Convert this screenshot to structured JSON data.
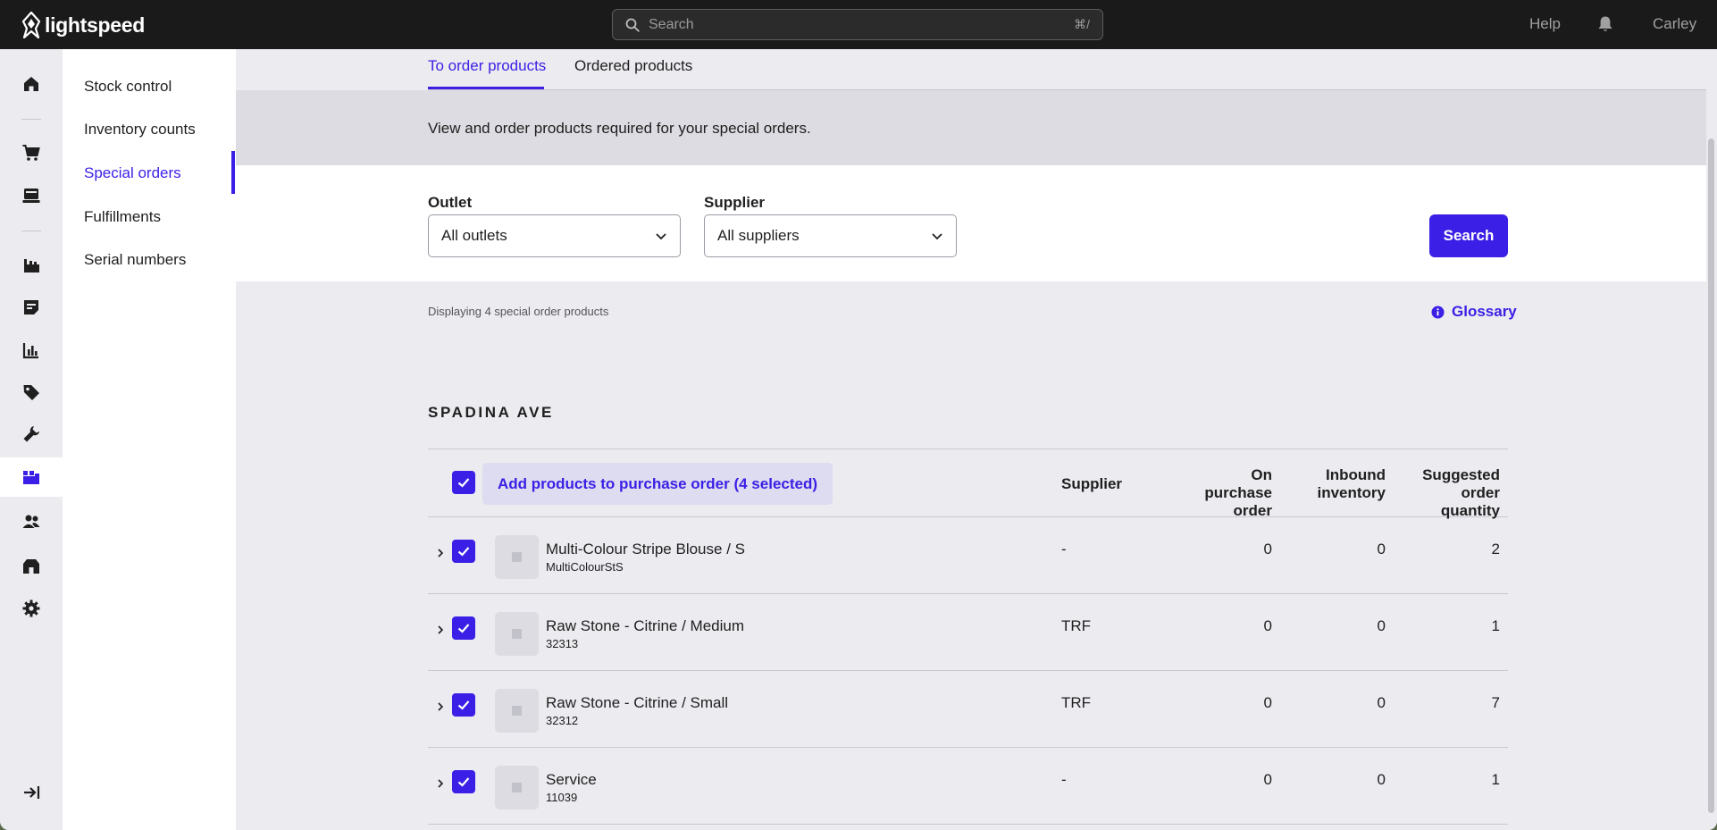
{
  "app": {
    "logo_text": "lightspeed",
    "search_placeholder": "Search",
    "search_shortcut": "⌘/",
    "help_label": "Help",
    "user_name": "Carley"
  },
  "rail": {
    "icons": [
      "home-icon",
      "cart-icon",
      "register-icon",
      "catalog-icon",
      "invoice-icon",
      "reports-icon",
      "tag-icon",
      "tools-icon",
      "inventory-icon",
      "customers-icon",
      "store-icon",
      "settings-icon",
      "collapse-icon"
    ],
    "active": "inventory-icon"
  },
  "subnav": {
    "items": [
      "Stock control",
      "Inventory counts",
      "Special orders",
      "Fulfillments",
      "Serial numbers"
    ],
    "active_index": 2
  },
  "tabs": {
    "to_order": "To order products",
    "ordered": "Ordered products",
    "active": "to_order"
  },
  "info_text": "View and order products required for your special orders.",
  "filters": {
    "outlet_label": "Outlet",
    "outlet_value": "All outlets",
    "supplier_label": "Supplier",
    "supplier_value": "All suppliers",
    "search_button": "Search"
  },
  "results": {
    "displaying_text": "Displaying 4 special order products",
    "glossary_label": "Glossary"
  },
  "outlet_section": {
    "title": "SPADINA AVE",
    "add_button": "Add products to purchase order (4 selected)",
    "columns": {
      "supplier": "Supplier",
      "on_purchase_order": "On purchase order",
      "inbound": "Inbound inventory",
      "suggested": "Suggested order quantity"
    },
    "rows": [
      {
        "name": "Multi-Colour Stripe Blouse / S",
        "sku": "MultiColourStS",
        "supplier": "-",
        "on_po": "0",
        "inbound": "0",
        "suggested": "2",
        "checked": true
      },
      {
        "name": "Raw Stone - Citrine / Medium",
        "sku": "32313",
        "supplier": "TRF",
        "on_po": "0",
        "inbound": "0",
        "suggested": "1",
        "checked": true
      },
      {
        "name": "Raw Stone - Citrine / Small",
        "sku": "32312",
        "supplier": "TRF",
        "on_po": "0",
        "inbound": "0",
        "suggested": "7",
        "checked": true
      },
      {
        "name": "Service",
        "sku": "11039",
        "supplier": "-",
        "on_po": "0",
        "inbound": "0",
        "suggested": "1",
        "checked": true
      }
    ]
  },
  "colors": {
    "accent": "#3b1fe6",
    "topbar": "#1a1a1a",
    "background": "#ebebf0",
    "band": "#dcdce2"
  }
}
